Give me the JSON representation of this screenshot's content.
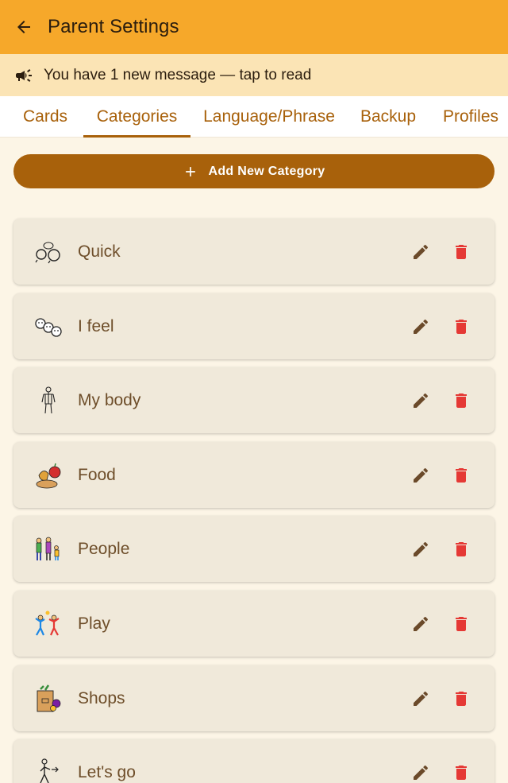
{
  "appbar": {
    "title": "Parent Settings",
    "back_icon": "arrow-left-icon"
  },
  "banner": {
    "text": "You have 1 new message — tap to read",
    "icon": "megaphone-icon"
  },
  "tabs": [
    {
      "label": "Cards",
      "active": false
    },
    {
      "label": "Categories",
      "active": true
    },
    {
      "label": "Language/Phrase",
      "active": false
    },
    {
      "label": "Backup",
      "active": false
    },
    {
      "label": "Profiles",
      "active": false
    }
  ],
  "add_button": {
    "label": "Add New Category",
    "icon": "plus-icon"
  },
  "categories": [
    {
      "label": "Quick",
      "icon": "speech-bubbles-icon"
    },
    {
      "label": "I feel",
      "icon": "faces-icon"
    },
    {
      "label": "My body",
      "icon": "body-icon"
    },
    {
      "label": "Food",
      "icon": "food-icon"
    },
    {
      "label": "People",
      "icon": "people-icon"
    },
    {
      "label": "Play",
      "icon": "play-icon"
    },
    {
      "label": "Shops",
      "icon": "shopping-bag-icon"
    },
    {
      "label": "Let's go",
      "icon": "walking-person-icon"
    }
  ],
  "colors": {
    "appbar": "#f6a82a",
    "banner": "#fbe4b5",
    "accent": "#a8610b",
    "card": "#f0e9da",
    "delete": "#e53935",
    "edit": "#6b4a2a"
  }
}
